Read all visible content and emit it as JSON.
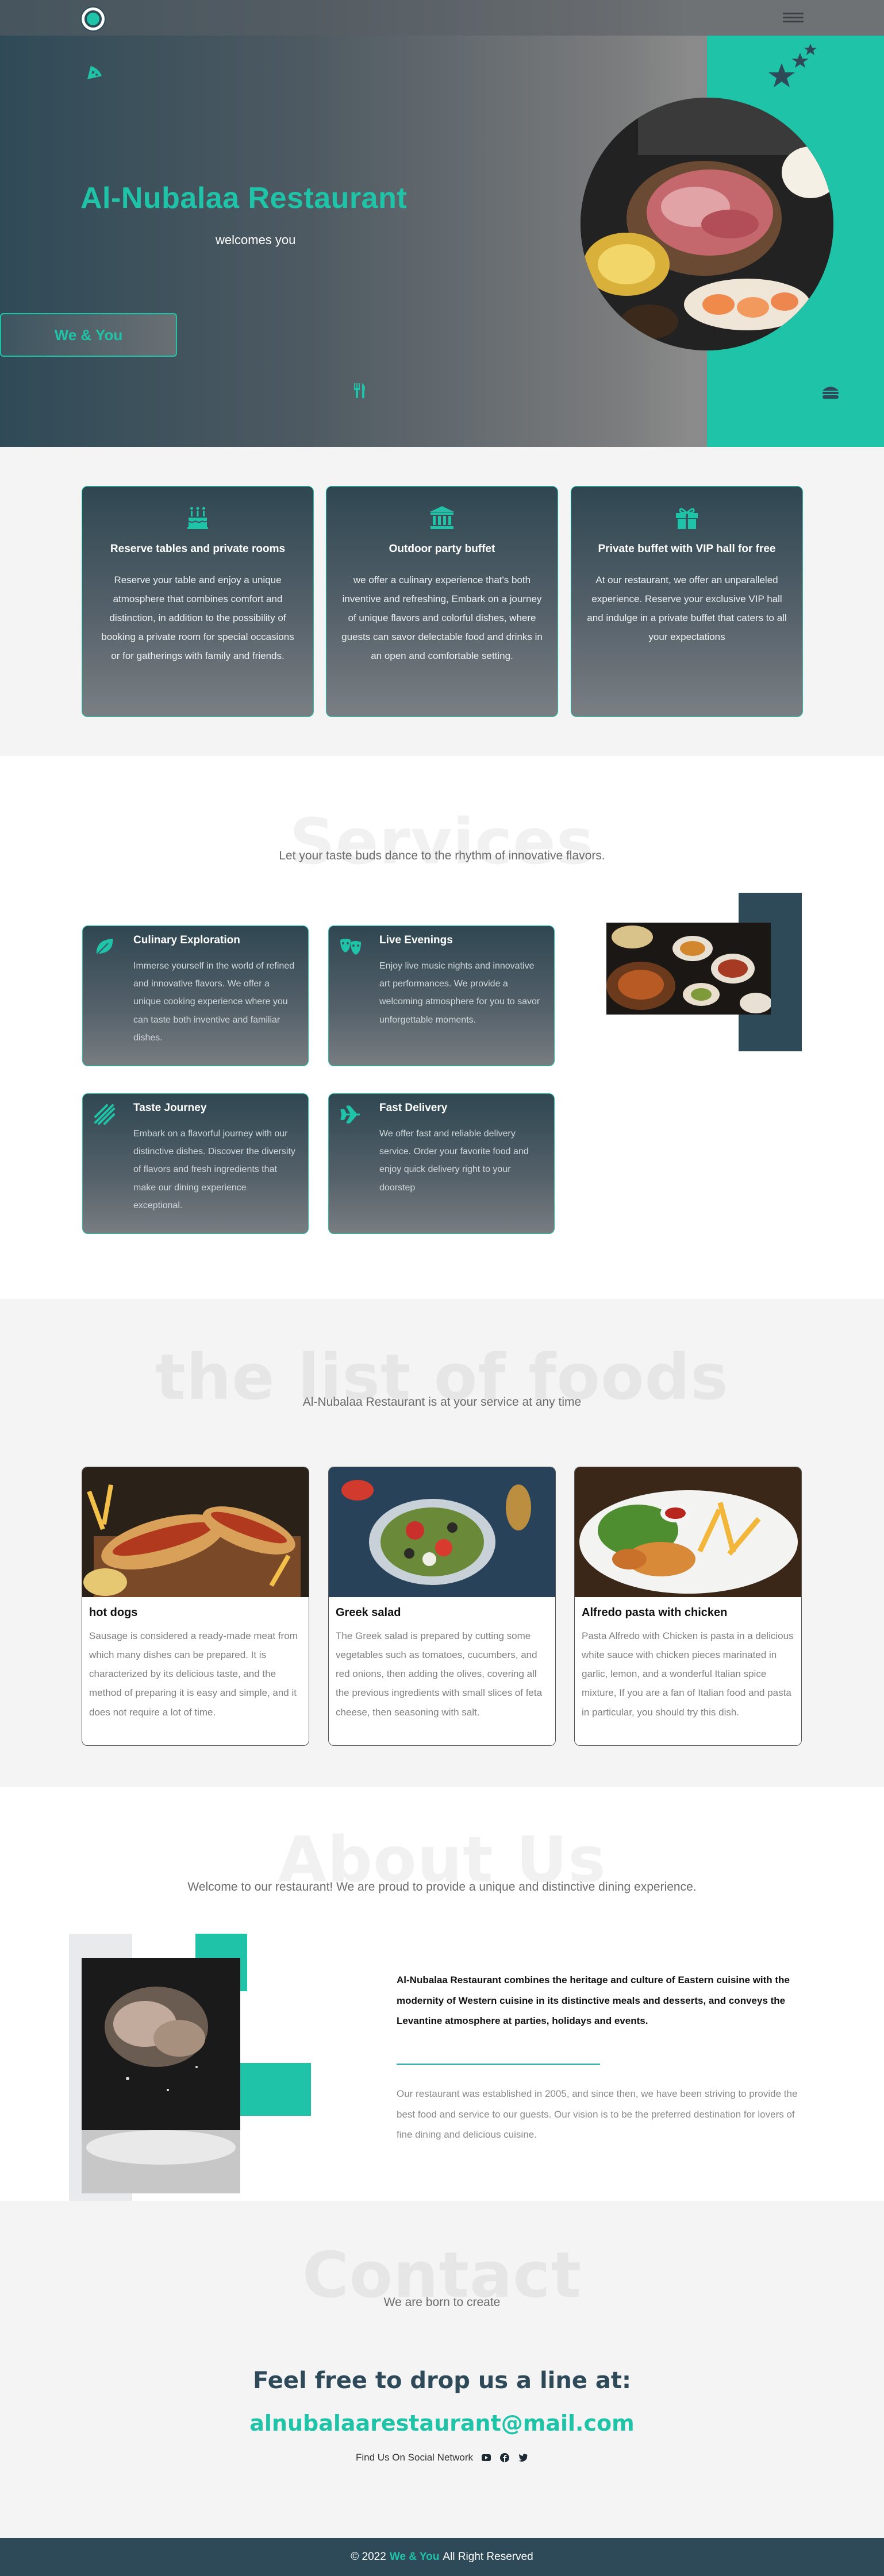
{
  "nav": {
    "logo_icon": "restaurant-logo",
    "menu_icon": "hamburger-menu-icon"
  },
  "hero": {
    "title": "Al-Nubalaa Restaurant",
    "subtitle": "welcomes you",
    "button_label": "We & You",
    "icons": [
      "pizza-slice-icon",
      "stars-icon",
      "utensils-icon",
      "burger-icon"
    ]
  },
  "features": [
    {
      "icon": "birthday-cake-icon",
      "title": "Reserve tables and private rooms",
      "text": "Reserve your table and enjoy a unique atmosphere that combines comfort and distinction, in addition to the possibility of booking a private room for special occasions or for gatherings with family and friends."
    },
    {
      "icon": "landmark-icon",
      "title": "Outdoor party buffet",
      "text": "we offer a culinary experience that's both inventive and refreshing, Embark on a journey of unique flavors and colorful dishes, where guests can savor delectable food and drinks in an open and comfortable setting."
    },
    {
      "icon": "gift-icon",
      "title": "Private buffet with VIP hall for free",
      "text": "At our restaurant, we offer an unparalleled experience. Reserve your exclusive VIP hall and indulge in a private buffet that caters to all your expectations"
    }
  ],
  "services": {
    "heading": "Services",
    "subtitle": "Let your taste buds dance to the rhythm of innovative flavors.",
    "items": [
      {
        "icon": "leaf-icon",
        "title": "Culinary Exploration",
        "text": "Immerse yourself in the world of refined and innovative flavors. We offer a unique cooking experience where you can taste both inventive and familiar dishes."
      },
      {
        "icon": "masks-icon",
        "title": "Live Evenings",
        "text": "Enjoy live music nights and innovative art performances. We provide a welcoming atmosphere for you to savor unforgettable moments."
      },
      {
        "icon": "stripes-icon",
        "title": "Taste Journey",
        "text": "Embark on a flavorful journey with our distinctive dishes. Discover the diversity of flavors and fresh ingredients that make our dining experience exceptional."
      },
      {
        "icon": "plane-icon",
        "title": "Fast Delivery",
        "text": "We offer fast and reliable delivery service. Order your favorite food and enjoy quick delivery right to your doorstep"
      }
    ]
  },
  "foods": {
    "heading": "the list of foods",
    "subtitle": "Al-Nubalaa Restaurant is at your service at any time",
    "items": [
      {
        "title": "hot dogs",
        "text": "Sausage is considered a ready-made meat from which many dishes can be prepared. It is characterized by its delicious taste, and the method of preparing it is easy and simple, and it does not require a lot of time."
      },
      {
        "title": "Greek salad",
        "text": "The Greek salad is prepared by cutting some vegetables such as tomatoes, cucumbers, and red onions, then adding the olives, covering all the previous ingredients with small slices of feta cheese, then seasoning with salt."
      },
      {
        "title": "Alfredo pasta with chicken",
        "text": "Pasta Alfredo with Chicken is pasta in a delicious white sauce with chicken pieces marinated in garlic, lemon, and a wonderful Italian spice mixture, If you are a fan of Italian food and pasta in particular, you should try this dish."
      }
    ]
  },
  "about": {
    "heading": "About Us",
    "subtitle": "Welcome to our restaurant! We are proud to provide a unique and distinctive dining experience.",
    "bold_text": "Al-Nubalaa Restaurant combines the heritage and culture of Eastern cuisine with the modernity of Western cuisine in its distinctive meals and desserts, and conveys the Levantine atmosphere at parties, holidays and events.",
    "text": "Our restaurant was established in 2005, and since then, we have been striving to provide the best food and service to our guests. Our vision is to be the preferred destination for lovers of fine dining and delicious cuisine."
  },
  "contact": {
    "heading": "Contact",
    "subtitle": "We are born to create",
    "line": "Feel free to drop us a line at:",
    "email": "alnubalaarestaurant@mail.com",
    "social_label": "Find Us On Social Network",
    "social_icons": [
      "youtube-icon",
      "facebook-icon",
      "twitter-icon"
    ]
  },
  "footer": {
    "copyright": "© 2022",
    "brand": "We & You",
    "rights": "All Right Reserved"
  },
  "colors": {
    "accent": "#1fc4a8",
    "dark": "#2e4a58"
  }
}
